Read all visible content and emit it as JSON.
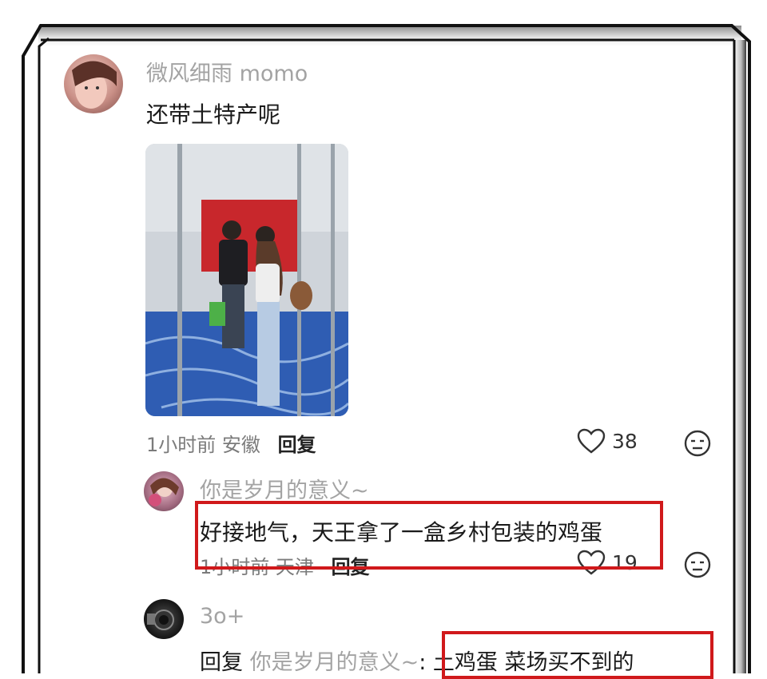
{
  "comment": {
    "username": "微风细雨 momo",
    "text": "还带土特产呢",
    "time": "1小时前",
    "location": "安徽",
    "reply_label": "回复",
    "likes": "38"
  },
  "reply1": {
    "username": "你是岁月的意义~",
    "text": "好接地气，天王拿了一盒乡村包装的鸡蛋",
    "time": "1小时前",
    "location": "天津",
    "reply_label": "回复",
    "likes": "19"
  },
  "reply2": {
    "username": "3o+",
    "reply_label": "回复",
    "reply_to": "你是岁月的意义~",
    "text": ": 土鸡蛋 菜场买不到的"
  },
  "colors": {
    "highlight_box": "#d0191b",
    "username": "#a3a3a3"
  }
}
